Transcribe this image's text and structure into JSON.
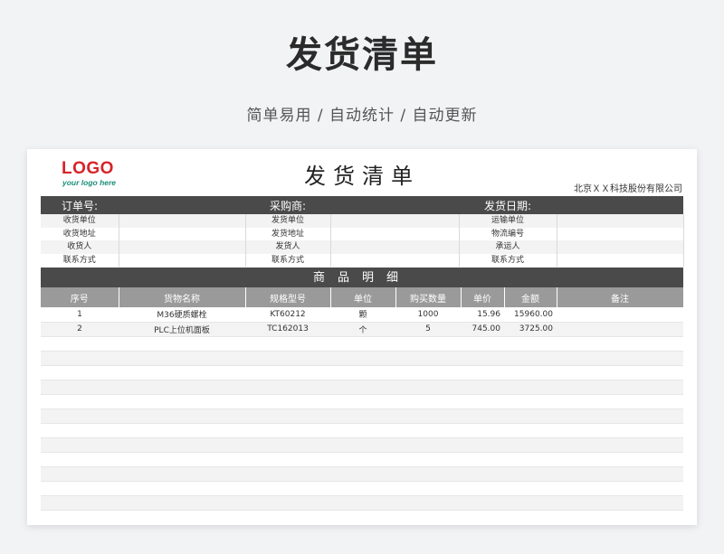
{
  "hero": {
    "title": "发货清单",
    "subtitle": "简单易用  /  自动统计  /  自动更新"
  },
  "sheet": {
    "logo": {
      "main": "LOGO",
      "tagline": "your logo here"
    },
    "title": "发货清单",
    "company": "北京ＸＸ科技股份有限公司",
    "header_bar": {
      "order_no": "订单号:",
      "buyer": "采购商:",
      "ship_date": "发货日期:"
    },
    "info_rows": [
      {
        "l1": "收货单位",
        "l2": "发货单位",
        "l3": "运输单位"
      },
      {
        "l1": "收货地址",
        "l2": "发货地址",
        "l3": "物流编号"
      },
      {
        "l1": "收货人",
        "l2": "发货人",
        "l3": "承运人"
      },
      {
        "l1": "联系方式",
        "l2": "联系方式",
        "l3": "联系方式"
      }
    ],
    "section_title": "商品明细",
    "columns": [
      "序号",
      "货物名称",
      "规格型号",
      "单位",
      "购买数量",
      "单价",
      "金额",
      "备注"
    ],
    "items": [
      [
        "1",
        "M36硬质螺栓",
        "KT60212",
        "颗",
        "1000",
        "15.96",
        "15960.00",
        ""
      ],
      [
        "2",
        "PLC上位机面板",
        "TC162013",
        "个",
        "5",
        "745.00",
        "3725.00",
        ""
      ]
    ],
    "empty_rows": 12
  },
  "colors": {
    "dark_bar": "#4a4a4a",
    "header_gray": "#9a9a9a",
    "logo_red": "#d8232a",
    "logo_teal": "#1a8f7a"
  }
}
